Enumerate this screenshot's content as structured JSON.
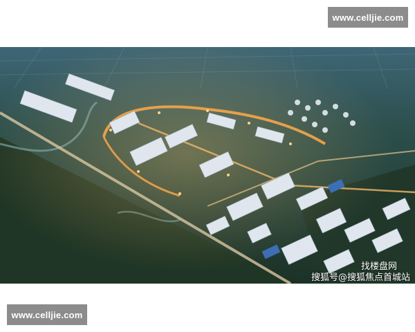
{
  "site_badge_top": "www.celljie.com",
  "site_badge_bottom": "www.celljie.com",
  "photo": {
    "subject": "aerial-night-rendering-industrial-park",
    "watermark_line1": "找楼盘网",
    "watermark_line2": "搜狐号@搜狐焦点首城站",
    "watermark_icon": "fox-logo-icon"
  }
}
